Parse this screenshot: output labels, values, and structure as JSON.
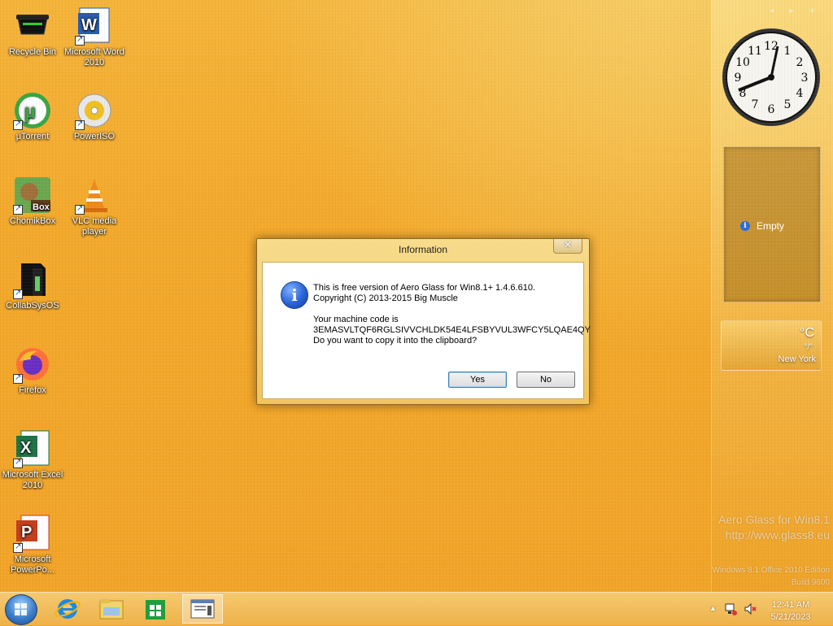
{
  "desktop_icons": [
    {
      "label": "Recycle Bin",
      "icon": "recycle-bin-icon"
    },
    {
      "label": "Microsoft Word 2010",
      "icon": "word-icon"
    },
    {
      "label": "µTorrent",
      "icon": "utorrent-icon"
    },
    {
      "label": "PowerISO",
      "icon": "poweriso-icon"
    },
    {
      "label": "ChomikBox",
      "icon": "chomikbox-icon"
    },
    {
      "label": "VLC media player",
      "icon": "vlc-icon"
    },
    {
      "label": "CollabSysOS",
      "icon": "collabsysos-icon"
    },
    {
      "label": "Firefox",
      "icon": "firefox-icon"
    },
    {
      "label": "Microsoft Excel 2010",
      "icon": "excel-icon"
    },
    {
      "label": "Microsoft PowerPo...",
      "icon": "powerpoint-icon"
    }
  ],
  "sidebar": {
    "nav": "◂ ▸ +",
    "clock_numbers": [
      "12",
      "1",
      "2",
      "3",
      "4",
      "5",
      "6",
      "7",
      "8",
      "9",
      "10",
      "11"
    ],
    "feed_text": "Empty",
    "weather": {
      "unit": "°C",
      "range": "°/°",
      "city": "New York"
    }
  },
  "watermark": {
    "line1": "Aero Glass for Win8.1",
    "line2": "http://www.glass8.eu",
    "edition": "Windows 8.1 Office 2010 Edition",
    "build": "Build 9600"
  },
  "dialog": {
    "title": "Information",
    "close": "✕",
    "line1": "This is free version of Aero Glass for Win8.1+ 1.4.6.610.",
    "line2": "Copyright (C) 2013-2015 Big Muscle",
    "line3": "Your machine code is",
    "line4": "3EMASVLTQF6RGLSIVVCHLDK54E4LFSBYVUL3WFCY5LQAE4QY",
    "line5": "Do you want to copy it into the clipboard?",
    "yes": "Yes",
    "no": "No"
  },
  "taskbar": {
    "time": "12:41 AM",
    "date": "5/21/2023",
    "tray_chevron": "▲"
  }
}
